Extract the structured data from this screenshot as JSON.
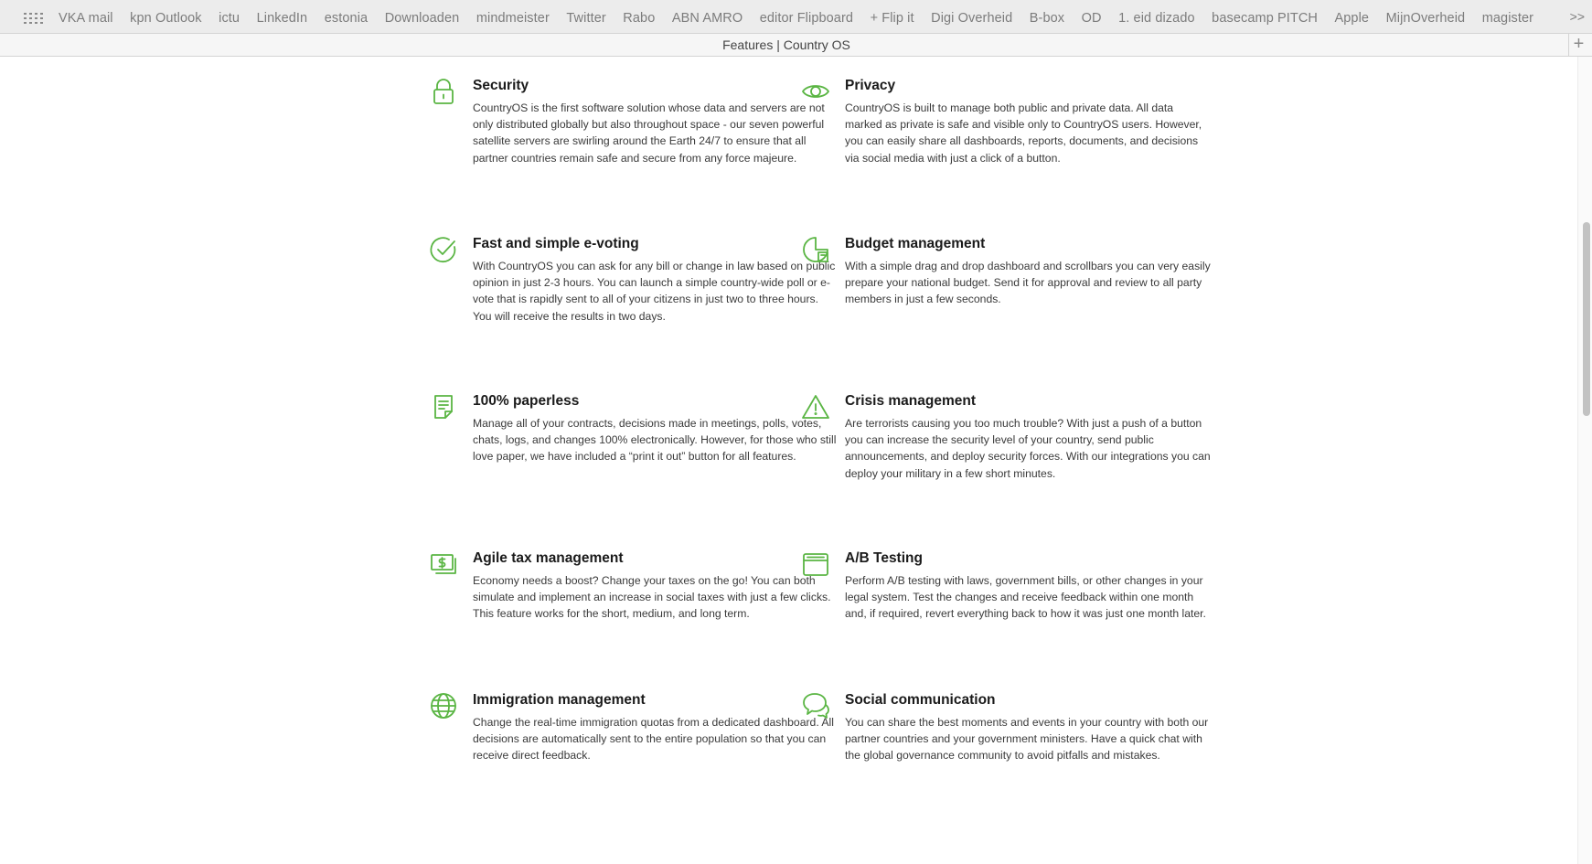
{
  "favorites": [
    "VKA mail",
    "kpn Outlook",
    "ictu",
    "LinkedIn",
    "estonia",
    "Downloaden",
    "mindmeister",
    "Twitter",
    "Rabo",
    "ABN AMRO",
    "editor Flipboard",
    "+ Flip it",
    "Digi Overheid",
    "B-box",
    "OD",
    "1. eid dizado",
    "basecamp PITCH",
    "Apple",
    "MijnOverheid",
    "magister"
  ],
  "favorites_more": ">>",
  "tab": {
    "title": "Features | Country OS",
    "new_tab": "+"
  },
  "accent_color": "#5ab543",
  "scrollbar": {
    "position": 0.27,
    "visible_fraction": 0.24
  },
  "features": {
    "security": {
      "icon": "lock-icon",
      "title": "Security",
      "body": "CountryOS is the first software solution whose data and servers are not only distributed globally but also throughout space - our seven powerful satellite servers are swirling around the Earth 24/7 to ensure that all partner countries remain safe and secure from any force majeure."
    },
    "privacy": {
      "icon": "eye-icon",
      "title": "Privacy",
      "body": "CountryOS is built to manage both public and private data. All data marked as private is safe and visible only to CountryOS users. However, you can easily share all dashboards, reports, documents, and decisions via social media with just a click of a button."
    },
    "evoting": {
      "icon": "check-circle-icon",
      "title": "Fast and simple e-voting",
      "body": "With CountryOS you can ask for any bill or change in law based on public opinion in just 2-3 hours. You can launch a simple country-wide poll or e-vote that is rapidly sent to all of your citizens in just two to three hours. You will receive the results in two days."
    },
    "budget": {
      "icon": "pie-chart-icon",
      "title": "Budget management",
      "body": "With a simple drag and drop dashboard and scrollbars you can very easily prepare your national budget. Send it for approval and review to all party members in just a few seconds."
    },
    "paperless": {
      "icon": "document-icon",
      "title": "100% paperless",
      "body": "Manage all of your contracts, decisions made in meetings, polls, votes, chats, logs, and changes 100% electronically. However, for those who still love paper, we have included a “print it out” button for all features."
    },
    "crisis": {
      "icon": "warning-icon",
      "title": "Crisis management",
      "body": "Are terrorists causing you too much trouble? With just a push of a button you can increase the security level of your country, send public announcements, and deploy security forces. With our integrations you can deploy your military in a few short minutes."
    },
    "tax": {
      "icon": "banknote-icon",
      "title": "Agile tax management",
      "body": "Economy needs a boost? Change your taxes on the go! You can both simulate and implement an increase in social taxes with just a few clicks. This feature works for the short, medium, and long term."
    },
    "abtesting": {
      "icon": "window-icon",
      "title": "A/B Testing",
      "body": "Perform A/B testing with laws, government bills, or other changes in your legal system. Test the changes and receive feedback within one month and, if required, revert everything back to how it was just one month later."
    },
    "immigration": {
      "icon": "globe-icon",
      "title": "Immigration management",
      "body": "Change the real-time immigration quotas from a dedicated dashboard. All decisions are automatically sent to the entire population so that you can receive direct feedback."
    },
    "social": {
      "icon": "chat-bubbles-icon",
      "title": "Social communication",
      "body": "You can share the best moments and events in your country with both our partner countries and your government ministers. Have a quick chat with the global governance community to avoid pitfalls and mistakes."
    }
  }
}
